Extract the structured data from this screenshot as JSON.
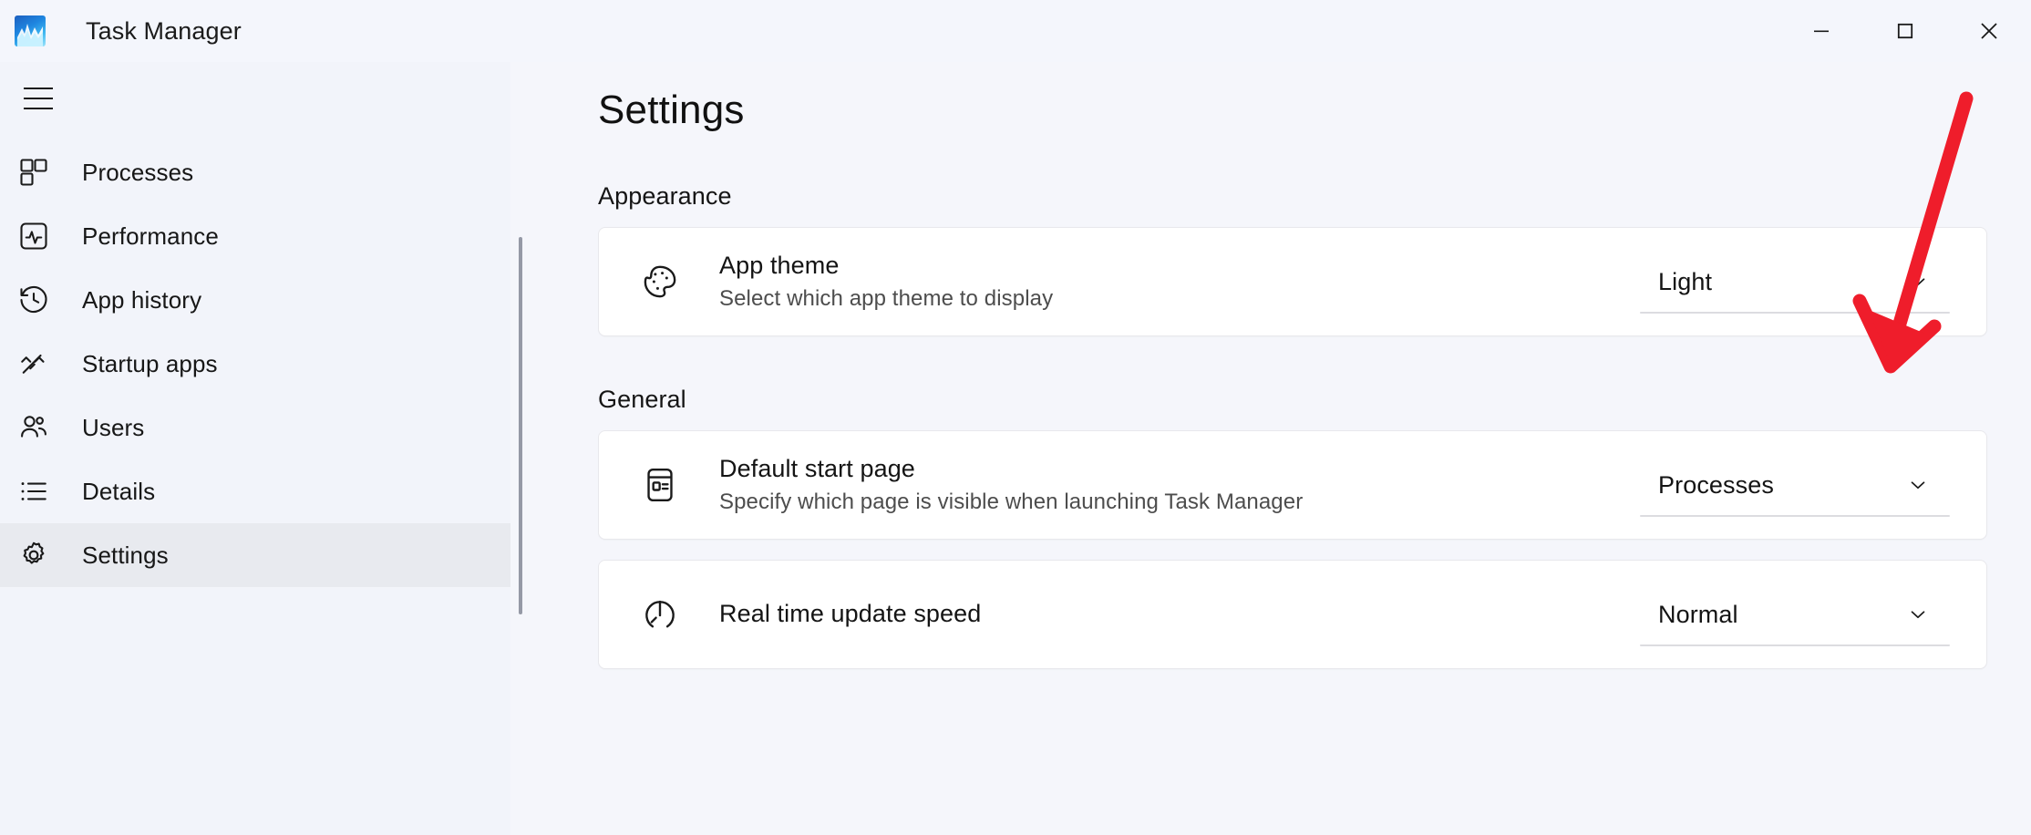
{
  "window": {
    "title": "Task Manager",
    "app_icon": "task-manager-icon",
    "controls": [
      {
        "name": "minimize",
        "glyph": "minimize-icon"
      },
      {
        "name": "maximize",
        "glyph": "maximize-icon"
      },
      {
        "name": "close",
        "glyph": "close-icon"
      }
    ]
  },
  "sidebar": {
    "menu_button": "hamburger-menu-icon",
    "items": [
      {
        "label": "Processes",
        "icon": "processes-icon",
        "selected": false
      },
      {
        "label": "Performance",
        "icon": "performance-icon",
        "selected": false
      },
      {
        "label": "App history",
        "icon": "app-history-icon",
        "selected": false
      },
      {
        "label": "Startup apps",
        "icon": "startup-apps-icon",
        "selected": false
      },
      {
        "label": "Users",
        "icon": "users-icon",
        "selected": false
      },
      {
        "label": "Details",
        "icon": "details-icon",
        "selected": false
      },
      {
        "label": "Settings",
        "icon": "settings-gear-icon",
        "selected": true
      }
    ]
  },
  "page": {
    "title": "Settings",
    "sections": [
      {
        "header": "Appearance",
        "rows": [
          {
            "icon": "palette-icon",
            "title": "App theme",
            "subtitle": "Select which app theme to display",
            "control": {
              "type": "dropdown",
              "value": "Light"
            }
          }
        ]
      },
      {
        "header": "General",
        "rows": [
          {
            "icon": "start-page-icon",
            "title": "Default start page",
            "subtitle": "Specify which page is visible when launching Task Manager",
            "control": {
              "type": "dropdown",
              "value": "Processes"
            }
          },
          {
            "icon": "speed-gauge-icon",
            "title": "Real time update speed",
            "subtitle": "",
            "control": {
              "type": "dropdown",
              "value": "Normal"
            }
          }
        ]
      }
    ]
  },
  "annotation": {
    "type": "arrow",
    "color": "#ef1d2b",
    "points_at": "app-theme-dropdown-chevron"
  },
  "colors": {
    "sidebar_bg": "#f2f4fa",
    "content_bg": "#f5f6fb",
    "card_bg": "#ffffff",
    "selected_item_bg": "#e8eaef",
    "text_primary": "#141414",
    "text_secondary": "#4d4d4d",
    "arrow_red": "#ef1d2b"
  }
}
